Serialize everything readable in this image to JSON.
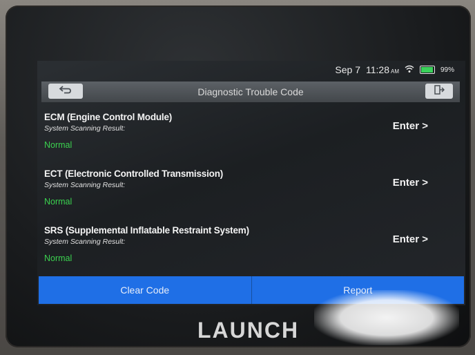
{
  "status_bar": {
    "date": "Sep 7",
    "time": "11:28",
    "ampm": "AM",
    "battery_pct": "99%",
    "battery_level": 0.99
  },
  "header": {
    "title": "Diagnostic Trouble Code",
    "back_icon": "back-arrow-icon",
    "exit_icon": "exit-icon"
  },
  "systems": [
    {
      "title": "ECM (Engine Control Module)",
      "subtitle": "System Scanning Result:",
      "status": "Normal",
      "action": "Enter >"
    },
    {
      "title": "ECT (Electronic Controlled Transmission)",
      "subtitle": "System Scanning Result:",
      "status": "Normal",
      "action": "Enter >"
    },
    {
      "title": "SRS (Supplemental Inflatable Restraint System)",
      "subtitle": "System Scanning Result:",
      "status": "Normal",
      "action": "Enter >"
    }
  ],
  "bottom_bar": {
    "clear_label": "Clear Code",
    "report_label": "Report"
  },
  "brand": "LAUNCH",
  "colors": {
    "accent_blue": "#1f6fe6",
    "status_green": "#3bd24f"
  }
}
